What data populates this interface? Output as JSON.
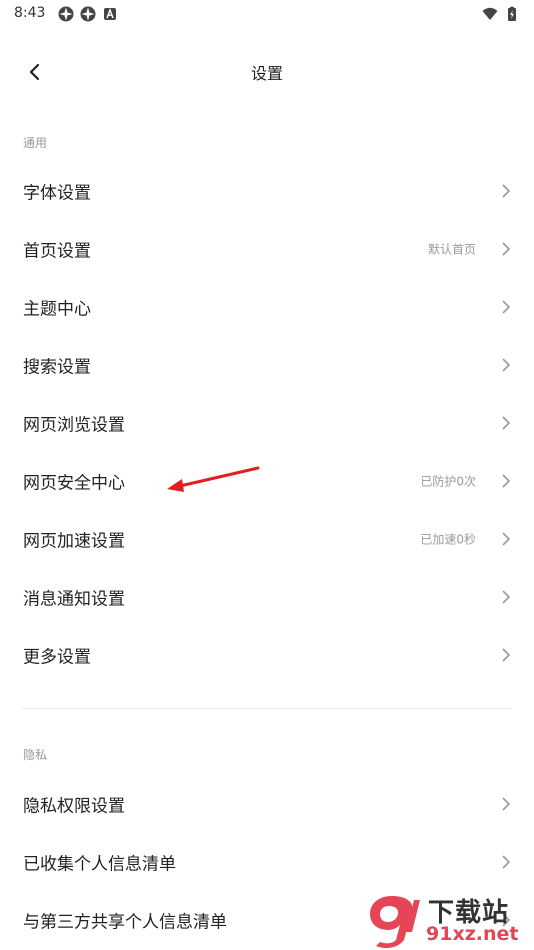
{
  "status_bar": {
    "time": "8:43",
    "left_icons": [
      "daisy-icon",
      "daisy-icon",
      "notification-a-icon"
    ],
    "right_icons": [
      "wifi-icon",
      "battery-charging-icon"
    ]
  },
  "header": {
    "title": "设置",
    "back_icon": "chevron-left-icon"
  },
  "sections": [
    {
      "label": "通用",
      "items": [
        {
          "label": "字体设置",
          "value": ""
        },
        {
          "label": "首页设置",
          "value": "默认首页"
        },
        {
          "label": "主题中心",
          "value": ""
        },
        {
          "label": "搜索设置",
          "value": ""
        },
        {
          "label": "网页浏览设置",
          "value": ""
        },
        {
          "label": "网页安全中心",
          "value": "已防护0次"
        },
        {
          "label": "网页加速设置",
          "value": "已加速0秒"
        },
        {
          "label": "消息通知设置",
          "value": ""
        },
        {
          "label": "更多设置",
          "value": ""
        }
      ]
    },
    {
      "label": "隐私",
      "items": [
        {
          "label": "隐私权限设置",
          "value": ""
        },
        {
          "label": "已收集个人信息清单",
          "value": ""
        },
        {
          "label": "与第三方共享个人信息清单",
          "value": ""
        }
      ]
    }
  ],
  "annotation": {
    "color": "#e02020"
  },
  "watermark": {
    "title": "下载站",
    "url": "91xz.net",
    "logo_color": "#e64555"
  }
}
